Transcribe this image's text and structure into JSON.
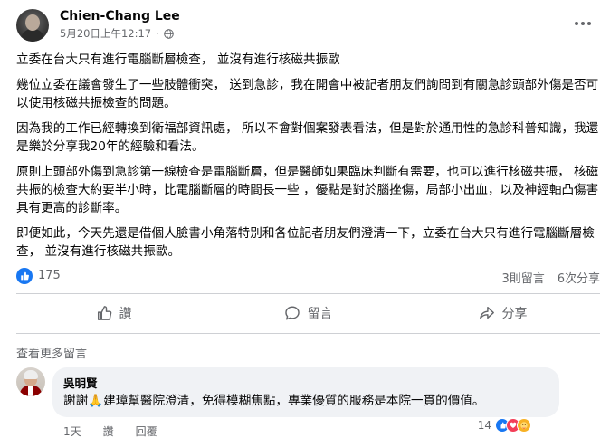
{
  "post": {
    "author": "Chien-Chang Lee",
    "timestamp": "5月20日上午12:17",
    "paragraphs": [
      "立委在台大只有進行電腦斷層檢查， 並沒有進行核磁共振歐",
      "幾位立委在議會發生了一些肢體衝突， 送到急診，我在開會中被記者朋友們詢問到有關急診頭部外傷是否可以使用核磁共振檢查的問題。",
      "因為我的工作已經轉換到衛福部資訊處， 所以不會對個案發表看法，但是對於通用性的急診科普知識，我還是樂於分享我20年的經驗和看法。",
      "原則上頭部外傷到急診第一線檢查是電腦斷層，但是醫師如果臨床判斷有需要，也可以進行核磁共振， 核磁共振的檢查大約要半小時，比電腦斷層的時間長一些 ，優點是對於腦挫傷，局部小出血，以及神經軸凸傷害具有更高的診斷率。",
      "即便如此，今天先還是借個人臉書小角落特別和各位記者朋友們澄清一下，立委在台大只有進行電腦斷層檢查， 並沒有進行核磁共振歐。"
    ],
    "like_count": "175",
    "comment_count": "3則留言",
    "share_count": "6次分享"
  },
  "actions": {
    "like": "讚",
    "comment": "留言",
    "share": "分享"
  },
  "see_more": "查看更多留言",
  "comment": {
    "author": "吳明賢",
    "text_before": "謝謝",
    "emoji": "🙏",
    "text_after": "建璋幫醫院澄清，免得模糊焦點，專業優質的服務是本院一貫的價值。",
    "time": "1天",
    "like": "讚",
    "reply": "回覆",
    "reaction_count": "14"
  },
  "colors": {
    "accent": "#1877f2",
    "secondary_text": "#65676b",
    "bubble_bg": "#f0f2f5"
  },
  "icons": [
    "globe-icon",
    "more-icon",
    "like-icon",
    "comment-icon",
    "share-icon",
    "like-reaction-icon",
    "love-reaction-icon",
    "care-reaction-icon"
  ]
}
